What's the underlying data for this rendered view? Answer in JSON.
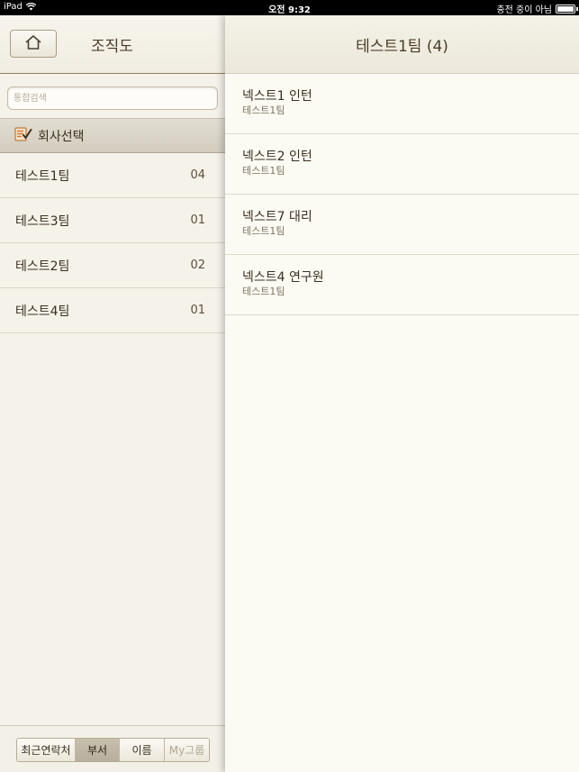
{
  "status_bar": {
    "device": "iPad",
    "time": "오전 9:32",
    "battery_text": "충전 중이 아님"
  },
  "left": {
    "title": "조직도",
    "search_placeholder": "통합검색",
    "company_select_label": "회사선택",
    "departments": [
      {
        "name": "테스트1팀",
        "count": "04"
      },
      {
        "name": "테스트3팀",
        "count": "01"
      },
      {
        "name": "테스트2팀",
        "count": "02"
      },
      {
        "name": "테스트4팀",
        "count": "01"
      }
    ],
    "tabs": [
      {
        "label": "최근연락처",
        "state": "normal"
      },
      {
        "label": "부서",
        "state": "active"
      },
      {
        "label": "이름",
        "state": "normal"
      },
      {
        "label": "My그룹",
        "state": "disabled"
      }
    ]
  },
  "right": {
    "title": "테스트1팀 (4)",
    "people": [
      {
        "name": "넥스트1 인턴",
        "dept": "테스트1팀"
      },
      {
        "name": "넥스트2 인턴",
        "dept": "테스트1팀"
      },
      {
        "name": "넥스트7 대리",
        "dept": "테스트1팀"
      },
      {
        "name": "넥스트4 연구원",
        "dept": "테스트1팀"
      }
    ]
  },
  "colors": {
    "background": "#f6f3ea",
    "header_border": "#8e7f5a",
    "active_tab": "#bdb5a2",
    "icon_orange": "#d9762b"
  },
  "icons": {
    "home": "home-icon",
    "company": "edit-checklist-icon",
    "wifi": "wifi-icon",
    "battery": "battery-icon"
  }
}
